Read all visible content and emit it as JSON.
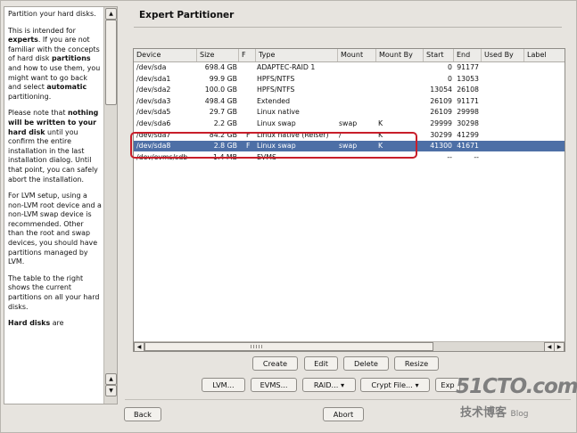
{
  "help": {
    "p1": "Partition your hard disks.",
    "p2_pre": "This is intended for ",
    "p2_b1": "experts",
    "p2_mid": ". If you are not familiar with the concepts of hard disk ",
    "p2_b2": "partitions",
    "p2_mid2": " and how to use them, you might want to go back and select ",
    "p2_b3": "automatic",
    "p2_post": " partitioning.",
    "p3_pre": "Please note that ",
    "p3_b": "nothing will be written to your hard disk",
    "p3_post": " until you confirm the entire installation in the last installation dialog. Until that point, you can safely abort the installation.",
    "p4": "For LVM setup, using a non-LVM root device and a non-LVM swap device is recommended. Other than the root and swap devices, you should have partitions managed by LVM.",
    "p5": "The table to the right shows the current partitions on all your hard disks.",
    "p6_b": "Hard disks",
    "p6_post": " are"
  },
  "title": "Expert Partitioner",
  "table": {
    "headers": [
      "Device",
      "Size",
      "F",
      "Type",
      "Mount",
      "Mount By",
      "Start",
      "End",
      "Used By",
      "Label"
    ],
    "rows": [
      {
        "device": "/dev/sda",
        "size": "698.4 GB",
        "f": "",
        "type": "ADAPTEC-RAID 1",
        "mount": "",
        "mountby": "",
        "start": "0",
        "end": "91177"
      },
      {
        "device": "/dev/sda1",
        "size": "99.9 GB",
        "f": "",
        "type": "HPFS/NTFS",
        "mount": "",
        "mountby": "",
        "start": "0",
        "end": "13053"
      },
      {
        "device": "/dev/sda2",
        "size": "100.0 GB",
        "f": "",
        "type": "HPFS/NTFS",
        "mount": "",
        "mountby": "",
        "start": "13054",
        "end": "26108"
      },
      {
        "device": "/dev/sda3",
        "size": "498.4 GB",
        "f": "",
        "type": "Extended",
        "mount": "",
        "mountby": "",
        "start": "26109",
        "end": "91171"
      },
      {
        "device": "/dev/sda5",
        "size": "29.7 GB",
        "f": "",
        "type": "Linux native",
        "mount": "",
        "mountby": "",
        "start": "26109",
        "end": "29998"
      },
      {
        "device": "/dev/sda6",
        "size": "2.2 GB",
        "f": "",
        "type": "Linux swap",
        "mount": "swap",
        "mountby": "K",
        "start": "29999",
        "end": "30298"
      },
      {
        "device": "/dev/sda7",
        "size": "84.2 GB",
        "f": "F",
        "type": "Linux native (Reiser)",
        "mount": "/",
        "mountby": "K",
        "start": "30299",
        "end": "41299"
      },
      {
        "device": "/dev/sda8",
        "size": "2.8 GB",
        "f": "F",
        "type": "Linux swap",
        "mount": "swap",
        "mountby": "K",
        "start": "41300",
        "end": "41671"
      },
      {
        "device": "/dev/evms/sdb",
        "size": "1.4 MB",
        "f": "",
        "type": "EVMS",
        "mount": "",
        "mountby": "",
        "start": "--",
        "end": "--"
      }
    ]
  },
  "actions": {
    "create": "Create",
    "edit": "Edit",
    "delete": "Delete",
    "resize": "Resize"
  },
  "tools": {
    "lvm": "LVM...",
    "evms": "EVMS...",
    "raid": "RAID...",
    "crypt": "Crypt File...",
    "expert": "Exp"
  },
  "nav": {
    "back": "Back",
    "abort": "Abort"
  },
  "watermark": {
    "main": "51CTO.com",
    "sub": "技术博客",
    "blog": "Blog"
  }
}
